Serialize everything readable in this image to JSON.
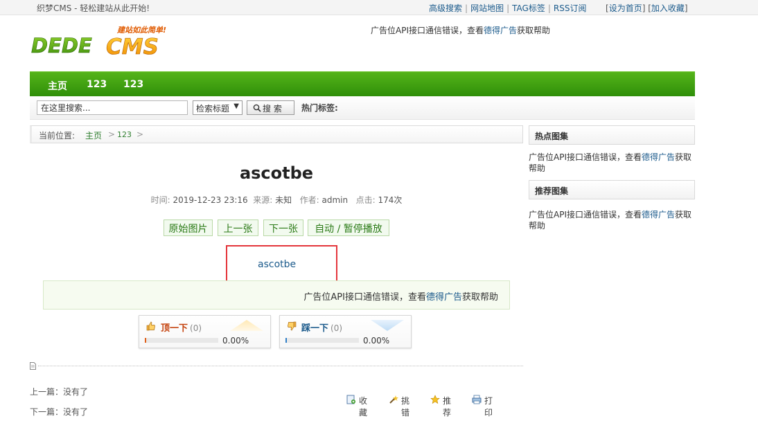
{
  "topbar": {
    "welcome": "织梦CMS - 轻松建站从此开始!",
    "links": [
      "高级搜索",
      "网站地图",
      "TAG标签",
      "RSS订阅"
    ],
    "set_home": "设为首页",
    "add_fav": "加入收藏"
  },
  "header": {
    "logo_text": "DEDECMS",
    "logo_slogan": "建站如此简单!",
    "ad_prefix": "广告位API接口通信错误，查看",
    "ad_link": "德得广告",
    "ad_suffix": "获取帮助"
  },
  "nav": {
    "items": [
      "主页",
      "123",
      "123"
    ]
  },
  "search": {
    "value": "在这里搜索...",
    "select": "检索标题",
    "button": "搜 索",
    "hot_tags": "热门标签:"
  },
  "breadcrumb": {
    "prefix": "当前位置:",
    "home": "主页",
    "sep": ">",
    "category": "123"
  },
  "article": {
    "title": "ascotbe",
    "time_label": "时间:",
    "time": "2019-12-23 23:16",
    "source_label": "来源:",
    "source": "未知",
    "author_label": "作者:",
    "author": "admin",
    "clicks_label": "点击:",
    "clicks": "174次",
    "pic_buttons": [
      "原始图片",
      "上一张",
      "下一张",
      "自动 / 暂停播放"
    ],
    "picture_link": "ascotbe",
    "ad_prefix": "广告位API接口通信错误，查看",
    "ad_link": "德得广告",
    "ad_suffix": "获取帮助"
  },
  "vote": {
    "up_label": "顶一下",
    "up_count": "(0)",
    "up_percent": "0.00%",
    "up_fraction": 0,
    "down_label": "踩一下",
    "down_count": "(0)",
    "down_percent": "0.00%",
    "down_fraction": 0
  },
  "prevnext": {
    "prev": "上一篇：没有了",
    "next": "下一篇：没有了"
  },
  "actions": [
    "收藏",
    "挑错",
    "推荐",
    "打印"
  ],
  "sidebar": {
    "hot_title": "热点图集",
    "rec_title": "推荐图集",
    "ad_prefix": "广告位API接口通信错误，查看",
    "ad_link": "德得广告",
    "ad_suffix": "获取帮助"
  },
  "colors": {
    "nav_green": "#2f8f09",
    "link_blue": "#1c5b8c",
    "highlight_red": "#e4353b"
  }
}
